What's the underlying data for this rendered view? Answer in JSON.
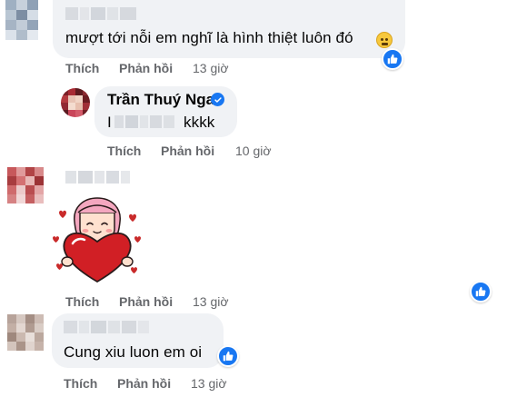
{
  "comments": [
    {
      "text": "mượt tới nỗi em nghĩ là hình thiệt luôn đó",
      "emoji": "thinking-face-emoji",
      "actions": {
        "like": "Thích",
        "reply": "Phản hồi",
        "time": "13 giờ"
      },
      "reaction": "like-icon"
    },
    {
      "author": "Trần Thuý Nga",
      "author_verified": true,
      "text_prefix": "I",
      "text_suffix": "kkkk",
      "actions": {
        "like": "Thích",
        "reply": "Phản hồi",
        "time": "10 giờ"
      }
    },
    {
      "sticker": "girl-holding-heart-sticker",
      "actions": {
        "like": "Thích",
        "reply": "Phản hồi",
        "time": "13 giờ"
      },
      "reaction": "like-icon"
    },
    {
      "text": "Cung xiu luon em oi",
      "actions": {
        "like": "Thích",
        "reply": "Phản hồi",
        "time": "13 giờ"
      },
      "reaction": "like-icon"
    }
  ],
  "colors": {
    "bubble": "#f0f2f5",
    "meta_text": "#65676b",
    "facebook_blue": "#1877f2"
  }
}
